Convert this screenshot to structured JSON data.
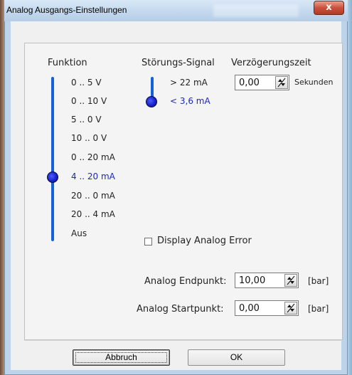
{
  "window": {
    "title": "Analog Ausgangs-Einstellungen",
    "close_symbol": "x"
  },
  "funktion": {
    "heading": "Funktion",
    "options": [
      "0 .. 5 V",
      "0 .. 10 V",
      "5 .. 0 V",
      "10 .. 0 V",
      "0 .. 20 mA",
      "4 .. 20 mA",
      "20 .. 0 mA",
      "20 .. 4 mA",
      "Aus"
    ],
    "selected_index": 5
  },
  "stoerung": {
    "heading": "Störungs-Signal",
    "options": [
      "> 22 mA",
      "< 3,6 mA"
    ],
    "selected_index": 1
  },
  "verzoegerung": {
    "heading": "Verzögerungszeit",
    "value": "0,00",
    "unit": "Sekunden"
  },
  "display_error": {
    "label": "Display Analog Error",
    "checked": false
  },
  "endpunkt": {
    "label": "Analog Endpunkt:",
    "value": "10,00",
    "unit": "[bar]"
  },
  "startpunkt": {
    "label": "Analog Startpunkt:",
    "value": "0,00",
    "unit": "[bar]"
  },
  "buttons": {
    "cancel": "Abbruch",
    "ok": "OK"
  },
  "colors": {
    "accent": "#1363d6",
    "knob": "#1a22c8",
    "selected_text": "#1f28b8"
  }
}
